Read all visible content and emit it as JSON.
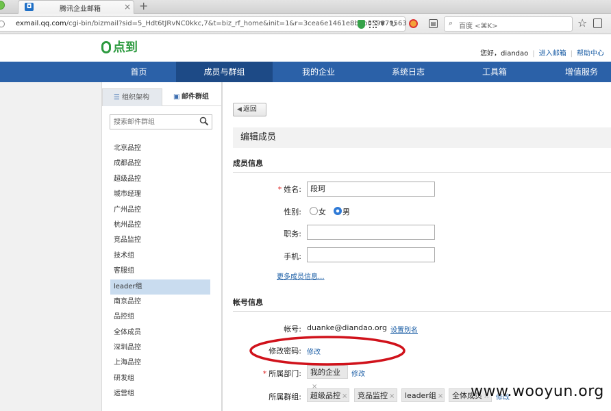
{
  "browser": {
    "tab_title": "腾讯企业邮箱",
    "tab_close": "×",
    "new_tab": "+",
    "url_host": "exmail.qq.com",
    "url_path": "/cgi-bin/bizmail?sid=5_Hdt6tJRvNC0kkc,7&t=biz_rf_home&init=1&r=3cea6e1461e8b5b859879563",
    "search_placeholder": "百度 <⌘K>"
  },
  "header": {
    "brand": "点到",
    "greeting": "您好，diandao",
    "link_enter_mailbox": "进入邮箱",
    "link_help": "帮助中心"
  },
  "nav": {
    "items": [
      {
        "label": "首页"
      },
      {
        "label": "成员与群组"
      },
      {
        "label": "我的企业"
      },
      {
        "label": "系统日志"
      },
      {
        "label": "工具箱"
      },
      {
        "label": "增值服务"
      }
    ],
    "active_index": 1
  },
  "sidebar": {
    "tab_org": "组织架构",
    "tab_groups": "邮件群组",
    "search_placeholder": "搜索邮件群组",
    "groups": [
      {
        "label": "北京品控"
      },
      {
        "label": "成都品控"
      },
      {
        "label": "超级品控"
      },
      {
        "label": "城市经理"
      },
      {
        "label": "广州品控"
      },
      {
        "label": "杭州品控"
      },
      {
        "label": "竞品监控"
      },
      {
        "label": "技术组"
      },
      {
        "label": "客服组"
      },
      {
        "label": "leader组"
      },
      {
        "label": "南京品控"
      },
      {
        "label": "品控组"
      },
      {
        "label": "全体成员"
      },
      {
        "label": "深圳品控"
      },
      {
        "label": "上海品控"
      },
      {
        "label": "研发组"
      },
      {
        "label": "运营组"
      }
    ],
    "selected": "leader组"
  },
  "content": {
    "back_label": "返回",
    "page_title": "编辑成员",
    "section_member": "成员信息",
    "label_name": "姓名:",
    "name_value": "段珂",
    "label_gender": "性别:",
    "gender_female": "女",
    "gender_male": "男",
    "gender_selected": "男",
    "label_title": "职务:",
    "title_value": "",
    "label_phone": "手机:",
    "phone_value": "",
    "more_info_link": "更多成员信息...",
    "section_account": "帐号信息",
    "label_account": "帐号:",
    "account_value": "duanke@diandao.org",
    "set_alias_link": "设置别名",
    "label_password": "修改密码:",
    "password_link": "修改",
    "label_department": "所属部门:",
    "department_tag": "我的企业",
    "department_edit": "修改",
    "label_groups": "所属群组:",
    "group_tags": [
      "超级品控",
      "竞品监控",
      "leader组",
      "全体成员"
    ],
    "groups_edit": "修改"
  },
  "overlay": {
    "watermark": "www.wooyun.org",
    "annotation_color": "#d0121b"
  }
}
